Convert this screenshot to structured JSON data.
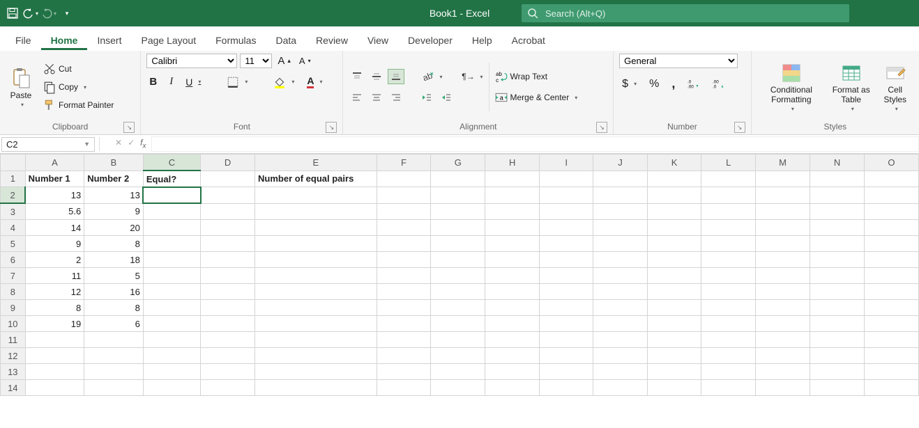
{
  "window": {
    "title": "Book1 - Excel",
    "search_placeholder": "Search (Alt+Q)"
  },
  "tabs": [
    "File",
    "Home",
    "Insert",
    "Page Layout",
    "Formulas",
    "Data",
    "Review",
    "View",
    "Developer",
    "Help",
    "Acrobat"
  ],
  "active_tab": "Home",
  "ribbon": {
    "clipboard": {
      "paste": "Paste",
      "cut": "Cut",
      "copy": "Copy",
      "painter": "Format Painter",
      "label": "Clipboard"
    },
    "font": {
      "name": "Calibri",
      "size": "11",
      "label": "Font"
    },
    "alignment": {
      "wrap": "Wrap Text",
      "merge": "Merge & Center",
      "label": "Alignment"
    },
    "number": {
      "format": "General",
      "label": "Number"
    },
    "styles": {
      "cond": "Conditional Formatting",
      "table": "Format as Table",
      "cell": "Cell Styles",
      "label": "Styles"
    }
  },
  "fx": {
    "namebox": "C2",
    "formula": ""
  },
  "columns": [
    "A",
    "B",
    "C",
    "D",
    "E",
    "F",
    "G",
    "H",
    "I",
    "J",
    "K",
    "L",
    "M",
    "N",
    "O"
  ],
  "selected_col": "C",
  "selected_row": 2,
  "rows": [
    1,
    2,
    3,
    4,
    5,
    6,
    7,
    8,
    9,
    10,
    11,
    12,
    13,
    14
  ],
  "cells": {
    "A1": "Number 1",
    "B1": "Number 2",
    "C1": "Equal?",
    "E1": "Number of equal pairs",
    "A2": "13",
    "B2": "13",
    "A3": "5.6",
    "B3": "9",
    "A4": "14",
    "B4": "20",
    "A5": "9",
    "B5": "8",
    "A6": "2",
    "B6": "18",
    "A7": "11",
    "B7": "5",
    "A8": "12",
    "B8": "16",
    "A9": "8",
    "B9": "8",
    "A10": "19",
    "B10": "6"
  },
  "chart_data": {
    "type": "table",
    "headers": [
      "Number 1",
      "Number 2",
      "Equal?"
    ],
    "rows": [
      [
        13,
        13,
        null
      ],
      [
        5.6,
        9,
        null
      ],
      [
        14,
        20,
        null
      ],
      [
        9,
        8,
        null
      ],
      [
        2,
        18,
        null
      ],
      [
        11,
        5,
        null
      ],
      [
        12,
        16,
        null
      ],
      [
        8,
        8,
        null
      ],
      [
        19,
        6,
        null
      ]
    ],
    "extra": {
      "E1": "Number of equal pairs"
    }
  }
}
